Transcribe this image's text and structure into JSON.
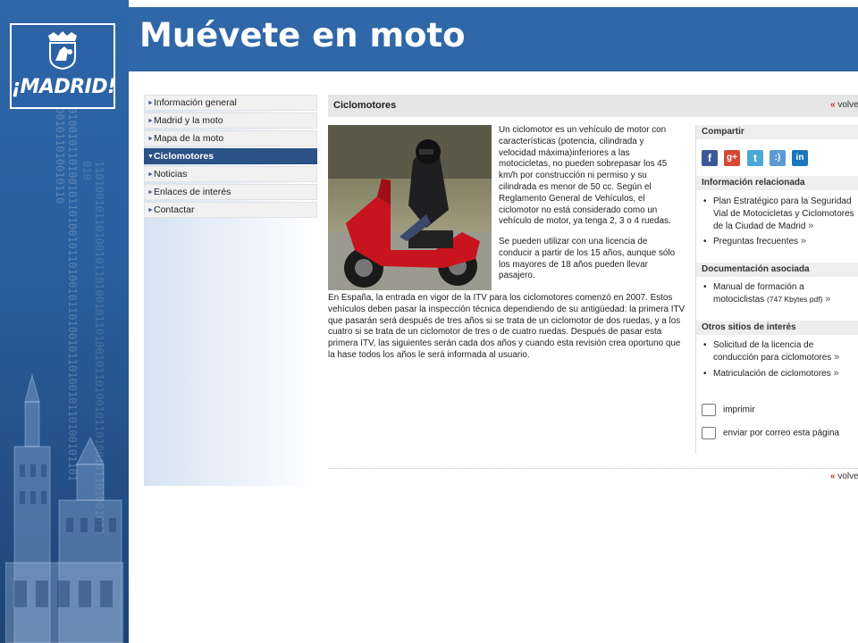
{
  "branding": {
    "logo_text": "¡MADRID!"
  },
  "slide": {
    "title": "Muévete en moto"
  },
  "nav": {
    "items": [
      {
        "label": "Información general",
        "active": false
      },
      {
        "label": "Madrid y la moto",
        "active": false
      },
      {
        "label": "Mapa de la moto",
        "active": false
      },
      {
        "label": "Ciclomotores",
        "active": true
      },
      {
        "label": "Noticias",
        "active": false
      },
      {
        "label": "Enlaces de interés",
        "active": false
      },
      {
        "label": "Contactar",
        "active": false
      }
    ]
  },
  "content": {
    "section_title": "Ciclomotores",
    "back_link": "volve",
    "back_quote": "«",
    "paragraphs": [
      "Un ciclomotor es un vehículo de motor con características (potencia, cilindrada y velocidad máxima)inferiores a las motocicletas, no pueden sobrepasar los 45 km/h por construcción ni permiso y su cilindrada es menor de 50 cc. Según el Reglamento General de Vehículos, el ciclomotor no está considerado como un vehículo de motor, ya tenga 2, 3 o 4 ruedas.",
      "Se pueden utilizar con una licencia de conducir a partir de los 15 años, aunque sólo los mayores de 18 años pueden llevar pasajero.",
      "En España, la entrada en vigor de la ITV para los ciclomotores comenzó en 2007. Estos vehículos deben pasar la inspección técnica dependiendo de su antigüedad: la primera ITV que pasarán será después de tres años si se trata de un ciclomotor de dos ruedas, y a los cuatro si se trata de un ciclomotor de tres o de cuatro ruedas. Después de pasar esta primera ITV, las siguientes serán cada dos años y cuando esta revisión crea oportuno que la hase todos los años le será informada al usuario."
    ]
  },
  "sidebar": {
    "share_title": "Compartir",
    "social": [
      {
        "name": "facebook-icon",
        "glyph": "f",
        "color": "#3b5998"
      },
      {
        "name": "google-plus-icon",
        "glyph": "g+",
        "color": "#d34836"
      },
      {
        "name": "twitter-icon",
        "glyph": "t",
        "color": "#4aa7d8"
      },
      {
        "name": "tuenti-icon",
        "glyph": ":)",
        "color": "#5b9bd5"
      },
      {
        "name": "linkedin-icon",
        "glyph": "in",
        "color": "#1b75bb"
      }
    ],
    "related_title": "Información relacionada",
    "related": [
      "Plan Estratégico para la Seguridad",
      "Vial de Motocicletas y Ciclomotores",
      "de la Ciudad de Madrid",
      "Preguntas frecuentes"
    ],
    "docs_title": "Documentación asociada",
    "docs": [
      "Manual de formación a",
      "motociclistas",
      "(747 Kbytes pdf)"
    ],
    "other_title": "Otros sitios de interés",
    "other": [
      "Solicitud de la licencia de",
      "conducción para ciclomotores",
      "Matriculación de ciclomotores"
    ],
    "bullet": "•",
    "arrow": "»",
    "print_label": "imprimir",
    "email_label": "enviar por correo esta página"
  },
  "colors": {
    "brand_blue": "#2f67a8",
    "nav_active": "#2c5186",
    "back_quote": "#c0392b"
  }
}
